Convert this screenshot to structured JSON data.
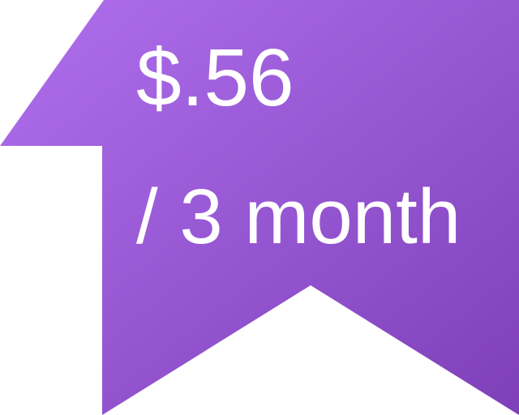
{
  "badge": {
    "price": "$.56",
    "period": "/ 3 month",
    "colors": {
      "gradient_start": "#b070ee",
      "gradient_end": "#7e3fb9",
      "text": "#ffffff"
    }
  }
}
